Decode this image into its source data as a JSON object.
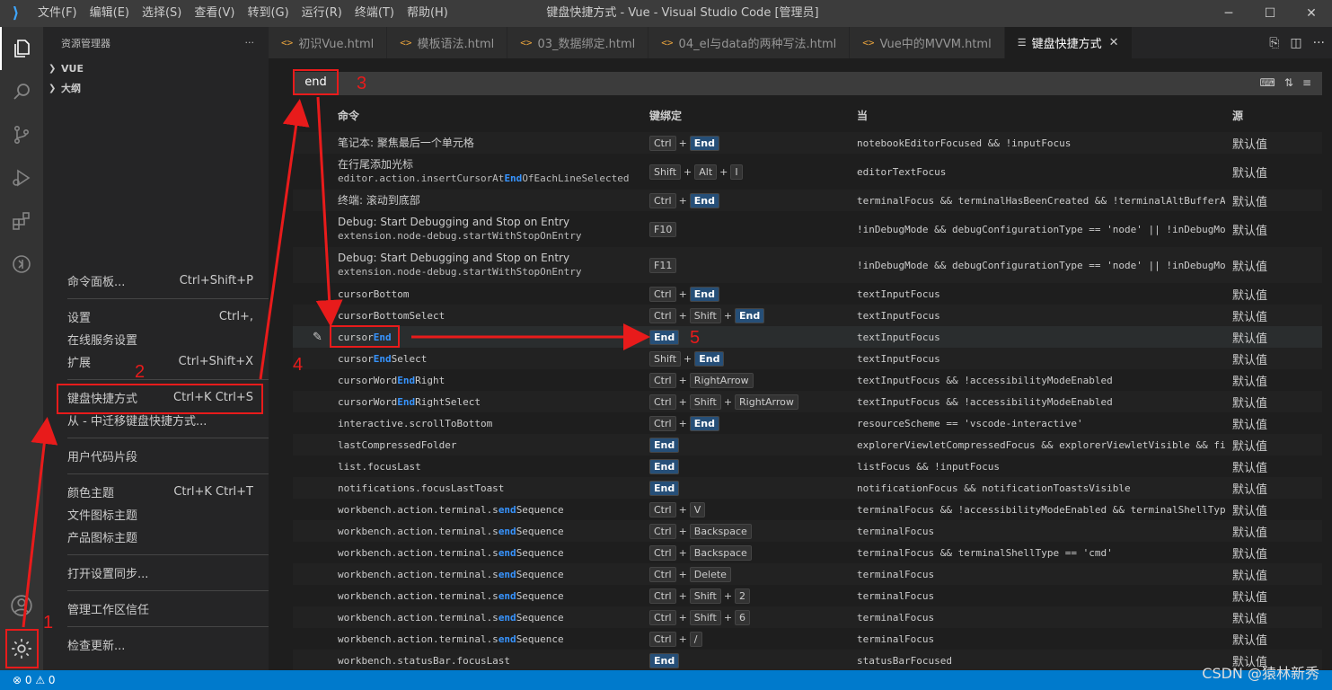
{
  "titlebar": {
    "logo": "⟩",
    "menus": [
      "文件(F)",
      "编辑(E)",
      "选择(S)",
      "查看(V)",
      "转到(G)",
      "运行(R)",
      "终端(T)",
      "帮助(H)"
    ],
    "title": "键盘快捷方式 - Vue - Visual Studio Code [管理员]",
    "minimize": "─",
    "maximize": "☐",
    "close": "✕"
  },
  "activity": {
    "icons": [
      "explorer-icon",
      "search-icon",
      "source-control-icon",
      "run-debug-icon",
      "extensions-icon",
      "remote-icon"
    ],
    "account": "account-icon",
    "manage": "gear-icon"
  },
  "sidebar": {
    "title": "资源管理器",
    "more": "···",
    "sections": [
      {
        "label": "VUE"
      },
      {
        "label": "大纲"
      }
    ]
  },
  "context_menu": {
    "groups": [
      [
        {
          "label": "命令面板...",
          "shortcut": "Ctrl+Shift+P"
        }
      ],
      [
        {
          "label": "设置",
          "shortcut": "Ctrl+,"
        },
        {
          "label": "在线服务设置",
          "shortcut": ""
        },
        {
          "label": "扩展",
          "shortcut": "Ctrl+Shift+X"
        }
      ],
      [
        {
          "label": "键盘快捷方式",
          "shortcut": "Ctrl+K Ctrl+S"
        },
        {
          "label": "从 - 中迁移键盘快捷方式...",
          "shortcut": ""
        }
      ],
      [
        {
          "label": "用户代码片段",
          "shortcut": ""
        }
      ],
      [
        {
          "label": "颜色主题",
          "shortcut": "Ctrl+K Ctrl+T"
        },
        {
          "label": "文件图标主题",
          "shortcut": ""
        },
        {
          "label": "产品图标主题",
          "shortcut": ""
        }
      ],
      [
        {
          "label": "打开设置同步...",
          "shortcut": ""
        }
      ],
      [
        {
          "label": "管理工作区信任",
          "shortcut": ""
        }
      ],
      [
        {
          "label": "检查更新...",
          "shortcut": ""
        }
      ]
    ]
  },
  "tabs": [
    {
      "label": "初识Vue.html",
      "icon": "<>"
    },
    {
      "label": "模板语法.html",
      "icon": "<>"
    },
    {
      "label": "03_数据绑定.html",
      "icon": "<>"
    },
    {
      "label": "04_el与data的两种写法.html",
      "icon": "<>"
    },
    {
      "label": "Vue中的MVVM.html",
      "icon": "<>"
    },
    {
      "label": "键盘快捷方式",
      "icon": "☰",
      "active": true,
      "close": "✕"
    }
  ],
  "search": {
    "value": "end"
  },
  "table": {
    "headers": [
      "命令",
      "键绑定",
      "当",
      "源"
    ],
    "rows": [
      {
        "cmd": "笔记本: 聚焦最后一个单元格",
        "sub": "",
        "keys": [
          [
            "Ctrl",
            false
          ],
          [
            "End",
            true
          ]
        ],
        "when": "notebookEditorFocused && !inputFocus",
        "src": "默认值",
        "h": 24
      },
      {
        "cmd": "在行尾添加光标",
        "sub": "editor.action.insertCursorAtEndOfEachLineSelected",
        "keys": [
          [
            "Shift",
            false
          ],
          [
            "Alt",
            false
          ],
          [
            "I",
            false
          ]
        ],
        "when": "editorTextFocus",
        "src": "默认值",
        "h": 40
      },
      {
        "cmd": "终端: 滚动到底部",
        "sub": "",
        "keys": [
          [
            "Ctrl",
            false
          ],
          [
            "End",
            true
          ]
        ],
        "when": "terminalFocus && terminalHasBeenCreated && !terminalAltBufferA...",
        "src": "默认值",
        "h": 24
      },
      {
        "cmd": "Debug: Start Debugging and Stop on Entry",
        "sub": "extension.node-debug.startWithStopOnEntry",
        "keys": [
          [
            "F10",
            false
          ]
        ],
        "when": "!inDebugMode && debugConfigurationType == 'node' || !inDebugMo...",
        "src": "默认值",
        "h": 40
      },
      {
        "cmd": "Debug: Start Debugging and Stop on Entry",
        "sub": "extension.node-debug.startWithStopOnEntry",
        "keys": [
          [
            "F11",
            false
          ]
        ],
        "when": "!inDebugMode && debugConfigurationType == 'node' || !inDebugMo...",
        "src": "默认值",
        "h": 40
      },
      {
        "cmd": "cursorBottom",
        "sub": "",
        "keys": [
          [
            "Ctrl",
            false
          ],
          [
            "End",
            true
          ]
        ],
        "when": "textInputFocus",
        "src": "默认值",
        "h": 24,
        "mono": true
      },
      {
        "cmd": "cursorBottomSelect",
        "sub": "",
        "keys": [
          [
            "Ctrl",
            false
          ],
          [
            "Shift",
            false
          ],
          [
            "End",
            true
          ]
        ],
        "when": "textInputFocus",
        "src": "默认值",
        "h": 24,
        "mono": true
      },
      {
        "cmd": "cursorEnd",
        "sub": "",
        "keys": [
          [
            "End",
            true
          ]
        ],
        "when": "textInputFocus",
        "src": "默认值",
        "h": 24,
        "mono": true,
        "sel": true,
        "edit": "✎"
      },
      {
        "cmd": "cursorEndSelect",
        "sub": "",
        "keys": [
          [
            "Shift",
            false
          ],
          [
            "End",
            true
          ]
        ],
        "when": "textInputFocus",
        "src": "默认值",
        "h": 24,
        "mono": true
      },
      {
        "cmd": "cursorWordEndRight",
        "sub": "",
        "keys": [
          [
            "Ctrl",
            false
          ],
          [
            "RightArrow",
            false
          ]
        ],
        "when": "textInputFocus && !accessibilityModeEnabled",
        "src": "默认值",
        "h": 24,
        "mono": true
      },
      {
        "cmd": "cursorWordEndRightSelect",
        "sub": "",
        "keys": [
          [
            "Ctrl",
            false
          ],
          [
            "Shift",
            false
          ],
          [
            "RightArrow",
            false
          ]
        ],
        "when": "textInputFocus && !accessibilityModeEnabled",
        "src": "默认值",
        "h": 24,
        "mono": true
      },
      {
        "cmd": "interactive.scrollToBottom",
        "sub": "",
        "keys": [
          [
            "Ctrl",
            false
          ],
          [
            "End",
            true
          ]
        ],
        "when": "resourceScheme == 'vscode-interactive'",
        "src": "默认值",
        "h": 24,
        "mono": true
      },
      {
        "cmd": "lastCompressedFolder",
        "sub": "",
        "keys": [
          [
            "End",
            true
          ]
        ],
        "when": "explorerViewletCompressedFocus && explorerViewletVisible && fi...",
        "src": "默认值",
        "h": 24,
        "mono": true
      },
      {
        "cmd": "list.focusLast",
        "sub": "",
        "keys": [
          [
            "End",
            true
          ]
        ],
        "when": "listFocus && !inputFocus",
        "src": "默认值",
        "h": 24,
        "mono": true
      },
      {
        "cmd": "notifications.focusLastToast",
        "sub": "",
        "keys": [
          [
            "End",
            true
          ]
        ],
        "when": "notificationFocus && notificationToastsVisible",
        "src": "默认值",
        "h": 24,
        "mono": true
      },
      {
        "cmd": "workbench.action.terminal.sendSequence",
        "sub": "",
        "keys": [
          [
            "Ctrl",
            false
          ],
          [
            "V",
            false
          ]
        ],
        "when": "terminalFocus && !accessibilityModeEnabled && terminalShellTyp...",
        "src": "默认值",
        "h": 24,
        "mono": true
      },
      {
        "cmd": "workbench.action.terminal.sendSequence",
        "sub": "",
        "keys": [
          [
            "Ctrl",
            false
          ],
          [
            "Backspace",
            false
          ]
        ],
        "when": "terminalFocus",
        "src": "默认值",
        "h": 24,
        "mono": true
      },
      {
        "cmd": "workbench.action.terminal.sendSequence",
        "sub": "",
        "keys": [
          [
            "Ctrl",
            false
          ],
          [
            "Backspace",
            false
          ]
        ],
        "when": "terminalFocus && terminalShellType == 'cmd'",
        "src": "默认值",
        "h": 24,
        "mono": true
      },
      {
        "cmd": "workbench.action.terminal.sendSequence",
        "sub": "",
        "keys": [
          [
            "Ctrl",
            false
          ],
          [
            "Delete",
            false
          ]
        ],
        "when": "terminalFocus",
        "src": "默认值",
        "h": 24,
        "mono": true
      },
      {
        "cmd": "workbench.action.terminal.sendSequence",
        "sub": "",
        "keys": [
          [
            "Ctrl",
            false
          ],
          [
            "Shift",
            false
          ],
          [
            "2",
            false
          ]
        ],
        "when": "terminalFocus",
        "src": "默认值",
        "h": 24,
        "mono": true
      },
      {
        "cmd": "workbench.action.terminal.sendSequence",
        "sub": "",
        "keys": [
          [
            "Ctrl",
            false
          ],
          [
            "Shift",
            false
          ],
          [
            "6",
            false
          ]
        ],
        "when": "terminalFocus",
        "src": "默认值",
        "h": 24,
        "mono": true
      },
      {
        "cmd": "workbench.action.terminal.sendSequence",
        "sub": "",
        "keys": [
          [
            "Ctrl",
            false
          ],
          [
            "/",
            false
          ]
        ],
        "when": "terminalFocus",
        "src": "默认值",
        "h": 24,
        "mono": true
      },
      {
        "cmd": "workbench.statusBar.focusLast",
        "sub": "",
        "keys": [
          [
            "End",
            true
          ]
        ],
        "when": "statusBarFocused",
        "src": "默认值",
        "h": 24,
        "mono": true
      }
    ]
  },
  "annotations": [
    "1",
    "2",
    "3",
    "4",
    "5"
  ],
  "statusbar": {
    "errors": "⊗ 0",
    "warnings": "⚠ 0"
  },
  "watermark": "CSDN @猿林新秀",
  "colors": {
    "accent": "#007acc",
    "highlight": "#3794ff",
    "annotation": "#e81b1b"
  }
}
